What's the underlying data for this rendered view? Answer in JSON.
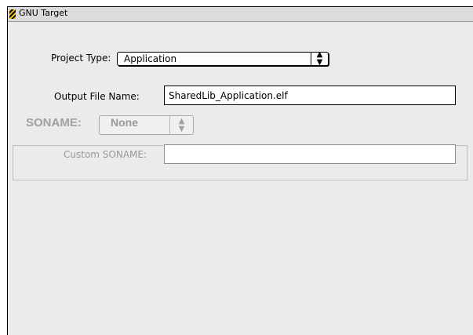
{
  "window": {
    "title": "GNU Target"
  },
  "project_type": {
    "label": "Project Type:",
    "value": "Application"
  },
  "output_file": {
    "label": "Output File Name:",
    "value": "SharedLib_Application.elf"
  },
  "soname": {
    "group_label": "SONAME:",
    "value": "None",
    "custom_label": "Custom SONAME:",
    "custom_value": ""
  },
  "icons": {
    "arrows": "up-down-arrows-icon",
    "app": "gnu-target-icon"
  }
}
